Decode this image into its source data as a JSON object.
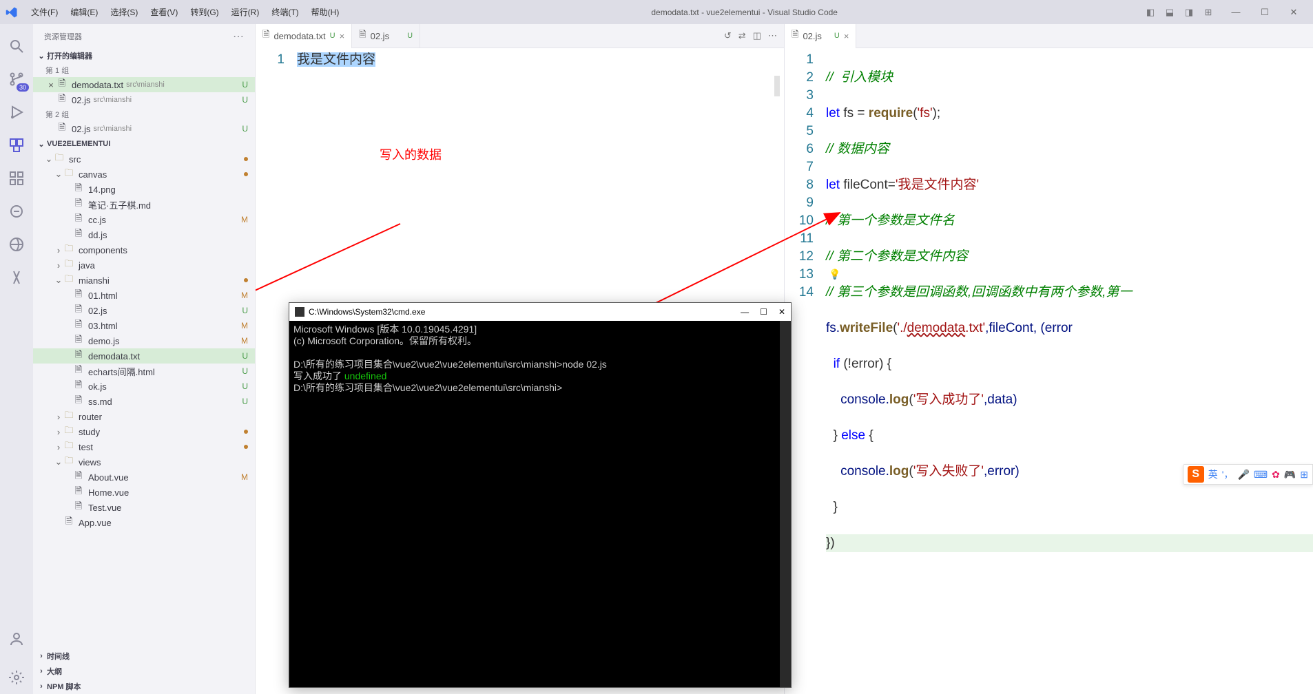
{
  "titlebar": {
    "menus": [
      "文件(F)",
      "编辑(E)",
      "选择(S)",
      "查看(V)",
      "转到(G)",
      "运行(R)",
      "终端(T)",
      "帮助(H)"
    ],
    "title": "demodata.txt - vue2elementui - Visual Studio Code"
  },
  "activity": {
    "badge": "30"
  },
  "sidebar": {
    "title": "资源管理器",
    "openEditors": {
      "label": "打开的编辑器",
      "groups": [
        "第 1 组",
        "第 2 组"
      ],
      "items": [
        {
          "name": "demodata.txt",
          "path": "src\\mianshi",
          "mod": "U",
          "active": true,
          "group": 0
        },
        {
          "name": "02.js",
          "path": "src\\mianshi",
          "mod": "U",
          "group": 0
        },
        {
          "name": "02.js",
          "path": "src\\mianshi",
          "mod": "U",
          "group": 1
        }
      ]
    },
    "project": "VUE2ELEMENTUI",
    "tree": [
      {
        "type": "folder",
        "name": "src",
        "depth": 0,
        "open": true,
        "dot": "M"
      },
      {
        "type": "folder",
        "name": "canvas",
        "depth": 1,
        "open": true,
        "dot": "M"
      },
      {
        "type": "file",
        "name": "14.png",
        "depth": 2
      },
      {
        "type": "file",
        "name": "笔记·五子棋.md",
        "depth": 2
      },
      {
        "type": "file",
        "name": "cc.js",
        "depth": 2,
        "mod": "M"
      },
      {
        "type": "file",
        "name": "dd.js",
        "depth": 2
      },
      {
        "type": "folder",
        "name": "components",
        "depth": 1,
        "open": false
      },
      {
        "type": "folder",
        "name": "java",
        "depth": 1,
        "open": false
      },
      {
        "type": "folder",
        "name": "mianshi",
        "depth": 1,
        "open": true,
        "dot": "M"
      },
      {
        "type": "file",
        "name": "01.html",
        "depth": 2,
        "mod": "M"
      },
      {
        "type": "file",
        "name": "02.js",
        "depth": 2,
        "mod": "U"
      },
      {
        "type": "file",
        "name": "03.html",
        "depth": 2,
        "mod": "M"
      },
      {
        "type": "file",
        "name": "demo.js",
        "depth": 2,
        "mod": "M"
      },
      {
        "type": "file",
        "name": "demodata.txt",
        "depth": 2,
        "mod": "U",
        "selected": true
      },
      {
        "type": "file",
        "name": "echarts间隔.html",
        "depth": 2,
        "mod": "U"
      },
      {
        "type": "file",
        "name": "ok.js",
        "depth": 2,
        "mod": "U"
      },
      {
        "type": "file",
        "name": "ss.md",
        "depth": 2,
        "mod": "U"
      },
      {
        "type": "folder",
        "name": "router",
        "depth": 1,
        "open": false
      },
      {
        "type": "folder",
        "name": "study",
        "depth": 1,
        "open": false,
        "dot": "M"
      },
      {
        "type": "folder",
        "name": "test",
        "depth": 1,
        "open": false,
        "dot": "M"
      },
      {
        "type": "folder",
        "name": "views",
        "depth": 1,
        "open": true
      },
      {
        "type": "file",
        "name": "About.vue",
        "depth": 2,
        "mod": "M"
      },
      {
        "type": "file",
        "name": "Home.vue",
        "depth": 2
      },
      {
        "type": "file",
        "name": "Test.vue",
        "depth": 2
      },
      {
        "type": "file",
        "name": "App.vue",
        "depth": 1
      }
    ],
    "bottomSections": [
      "时间线",
      "大纲",
      "NPM 脚本"
    ]
  },
  "editorLeft": {
    "tabs": [
      {
        "name": "demodata.txt",
        "mod": "U",
        "active": true,
        "close": "×"
      },
      {
        "name": "02.js",
        "mod": "U"
      }
    ],
    "lines": [
      "1"
    ],
    "content": "我是文件内容",
    "annotation": "写入的数据"
  },
  "editorRight": {
    "tabs": [
      {
        "name": "02.js",
        "mod": "U",
        "active": true,
        "close": "×"
      }
    ],
    "lineNumbers": [
      "1",
      "2",
      "3",
      "4",
      "5",
      "6",
      "7",
      "8",
      "9",
      "10",
      "11",
      "12",
      "13",
      "14"
    ],
    "code": {
      "l1": "//  引入模块",
      "l2a": "let",
      "l2b": " fs = ",
      "l2c": "require",
      "l2d": "(",
      "l2e": "'fs'",
      "l2f": ");",
      "l3": "// 数据内容",
      "l4a": "let",
      "l4b": " fileCont=",
      "l4c": "'我是文件内容'",
      "l5": "// 第一个参数是文件名",
      "l6": "// 第二个参数是文件内容",
      "l7": "// 第三个参数是回调函数,回调函数中有两个参数,第一",
      "l8a": "fs.",
      "l8b": "writeFile",
      "l8c": "(",
      "l8d": "'./",
      "l8e": "demodata",
      "l8f": ".txt'",
      "l8g": ",fileCont, (error",
      "l9a": "  ",
      "l9b": "if",
      "l9c": " (!error) {",
      "l10a": "    console.",
      "l10b": "log",
      "l10c": "(",
      "l10d": "'写入成功了'",
      "l10e": ",data)",
      "l11a": "  } ",
      "l11b": "else",
      "l11c": " {",
      "l12a": "    console.",
      "l12b": "log",
      "l12c": "(",
      "l12d": "'写入失败了'",
      "l12e": ",error)",
      "l13": "  }",
      "l14": "})"
    }
  },
  "cmd": {
    "title": "C:\\Windows\\System32\\cmd.exe",
    "body": "Microsoft Windows [版本 10.0.19045.4291]\n(c) Microsoft Corporation。保留所有权利。\n\nD:\\所有的练习项目集合\\vue2\\vue2\\vue2elementui\\src\\mianshi>node 02.js\n",
    "success": "写入成功了 ",
    "undef": "undefined",
    "prompt": "\nD:\\所有的练习项目集合\\vue2\\vue2\\vue2elementui\\src\\mianshi>"
  },
  "ime": {
    "lang": "英"
  }
}
